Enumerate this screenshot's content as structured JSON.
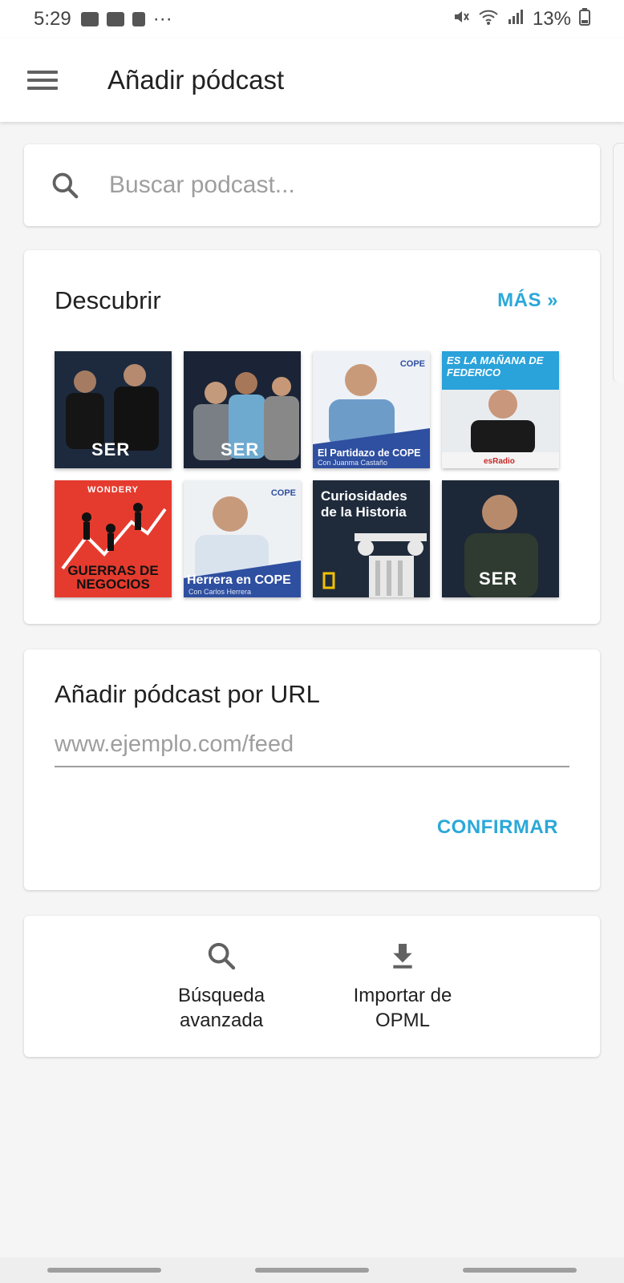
{
  "status": {
    "time": "5:29",
    "battery": "13%",
    "more": "···"
  },
  "appbar": {
    "title": "Añadir pódcast"
  },
  "search": {
    "placeholder": "Buscar podcast..."
  },
  "discover": {
    "heading": "Descubrir",
    "more_label": "MÁS »",
    "tiles": [
      {
        "label": "SER"
      },
      {
        "label": "SER"
      },
      {
        "label": "El Partidazo de COPE",
        "sub": "Con Juanma Castaño",
        "badge": "COPE"
      },
      {
        "label": "ES LA MAÑANA DE FEDERICO",
        "sub": "esRadio"
      },
      {
        "label": "GUERRAS DE NEGOCIOS",
        "top": "WONDERY"
      },
      {
        "label": "Herrera en COPE",
        "sub": "Con Carlos Herrera",
        "badge": "COPE"
      },
      {
        "label": "Curiosidades de la Historia"
      },
      {
        "label": "SER"
      }
    ]
  },
  "url_section": {
    "heading": "Añadir pódcast por URL",
    "placeholder": "www.ejemplo.com/feed",
    "confirm_label": "CONFIRMAR"
  },
  "actions": [
    {
      "label": "Búsqueda avanzada",
      "icon": "search-icon"
    },
    {
      "label": "Importar de OPML",
      "icon": "download-icon"
    }
  ],
  "colors": {
    "accent": "#2ba8d9"
  }
}
